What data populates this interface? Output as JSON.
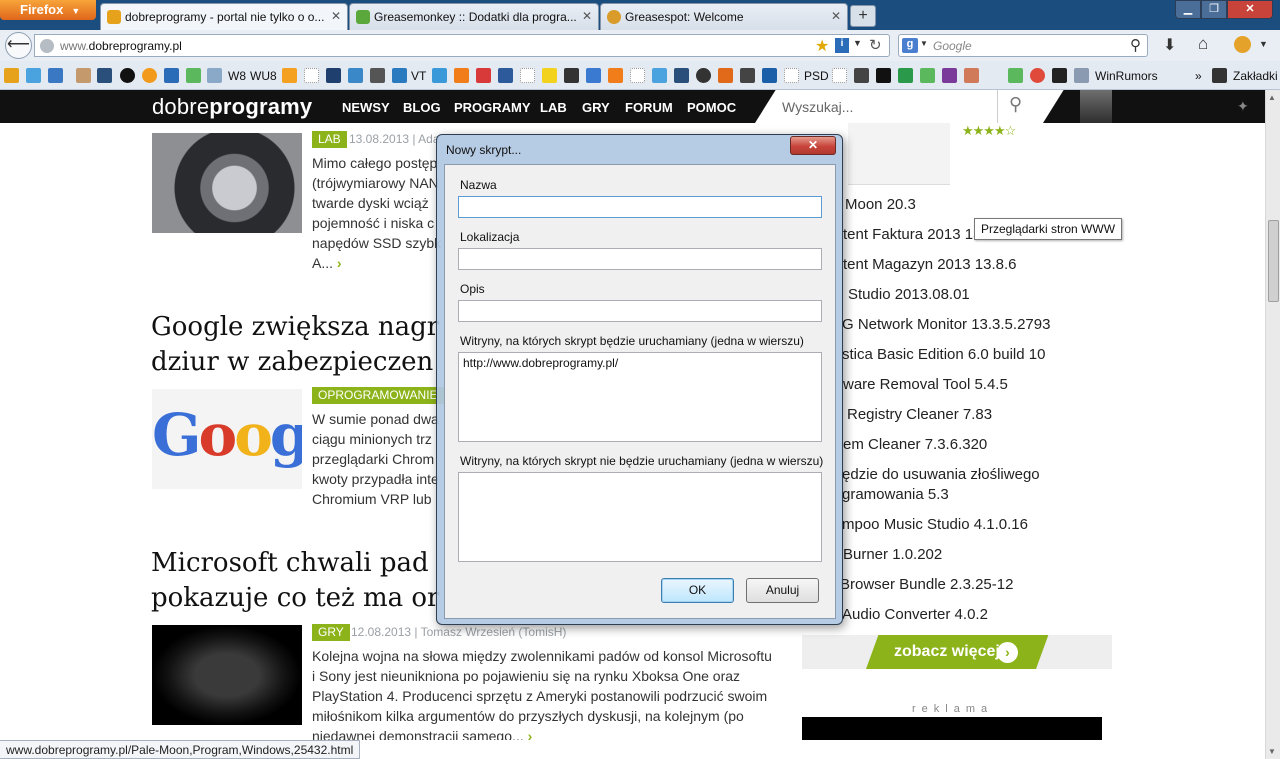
{
  "browser": {
    "menu_button": "Firefox",
    "tabs": [
      {
        "title": "dobreprogramy - portal nie tylko o o...",
        "active": true
      },
      {
        "title": "Greasemonkey :: Dodatki dla progra...",
        "active": false
      },
      {
        "title": "Greasespot: Welcome",
        "active": false
      }
    ],
    "url_prefix": "www.",
    "url_domain": "dobreprogramy.pl",
    "search_placeholder": "Google",
    "bookmarks": [
      "W8",
      "WU8",
      "VT",
      "PSD",
      "WinRumors",
      "Zakładki"
    ]
  },
  "site": {
    "logo_light": "dobre",
    "logo_bold": "programy",
    "nav": [
      "NEWSY",
      "BLOG",
      "PROGRAMY",
      "LAB",
      "GRY",
      "FORUM",
      "POMOC"
    ],
    "search_placeholder": "Wyszukaj..."
  },
  "articles": [
    {
      "tag": "LAB",
      "meta": "13.08.2013 | Ada",
      "lines": [
        "Mimo całego postęp",
        "(trójwymiarowy NAN",
        "twarde dyski wciąż",
        "pojemność i niska c",
        "napędów SSD szybk",
        "A..."
      ]
    },
    {
      "headline_lines": [
        "Google zwiększa nagr",
        "dziur w zabezpieczen"
      ],
      "tag": "OPROGRAMOWANIE",
      "lines": [
        "W sumie ponad dwa",
        "ciągu minionych trz",
        "przeglądarki Chrom",
        "kwoty przypadła inte",
        "Chromium VRP lub "
      ]
    },
    {
      "headline_lines": [
        "Microsoft chwali pad",
        "pokazuje co też ma or"
      ],
      "tag": "GRY",
      "meta": "12.08.2013 | Tomasz Wrzesień (TomisH)",
      "lines": [
        "Kolejna wojna na słowa między zwolennikami padów od konsol Microsoftu",
        "i Sony jest nieuniknionа po pojawieniu się na rynku Xboksa One oraz",
        "PlayStation 4. Producenci sprzętu z Ameryki postanowili podrzucić swoim",
        "miłośnikom kilka argumentów do przyszłych dyskusji, na kolejnym (po",
        "niedawnej demonstracji samego..."
      ]
    }
  ],
  "sidebar": {
    "items": [
      "Moon 20.3",
      "tent Faktura 2013 13.8",
      "tent Magazyn 2013 13.8.6",
      "Studio 2013.08.01",
      "G Network Monitor 13.3.5.2793",
      "stica Basic Edition 6.0 build 10",
      "ware Removal Tool 5.4.5",
      "Registry Cleaner 7.83",
      "em Cleaner 7.3.6.320",
      "ędzie do usuwania złośliwego",
      "gramowania 5.3",
      "mpoo Music Studio 4.1.0.16",
      "Burner 1.0.202",
      "Browser Bundle 2.3.25-12",
      "Audio Converter 4.0.2"
    ],
    "more_label": "zobacz więcej",
    "ad_label": "reklama"
  },
  "tooltip": "Przeglądarki stron WWW",
  "status_url": "www.dobreprogramy.pl/Pale-Moon,Program,Windows,25432.html",
  "dialog": {
    "title": "Nowy skrypt...",
    "close_label": "✕",
    "name_label": "Nazwa",
    "name_value": "",
    "location_label": "Lokalizacja",
    "location_value": "",
    "desc_label": "Opis",
    "desc_value": "",
    "include_label": "Witryny, na których skrypt będzie uruchamiany (jedna w wierszu)",
    "include_value": "http://www.dobreprogramy.pl/",
    "exclude_label": "Witryny, na których skrypt nie będzie uruchamiany (jedna w wierszu)",
    "exclude_value": "",
    "ok_label": "OK",
    "cancel_label": "Anuluj"
  }
}
